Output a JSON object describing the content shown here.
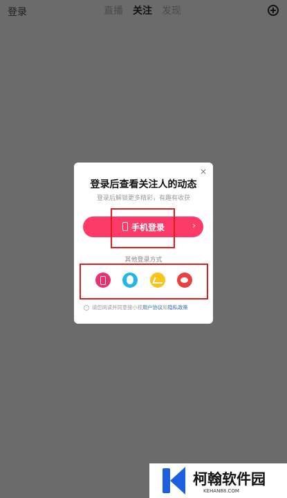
{
  "topbar": {
    "login_label": "登录",
    "tabs": [
      {
        "label": "直播",
        "active": false
      },
      {
        "label": "关注",
        "active": true
      },
      {
        "label": "发现",
        "active": false
      }
    ],
    "add_icon": "plus-circle-icon"
  },
  "dialog": {
    "close_glyph": "×",
    "title": "登录后查看关注人的动态",
    "subtitle": "登录后解锁更多精彩，有趣有收获",
    "phone_login": {
      "label": "手机登录",
      "arrow": "›",
      "icon": "phone-icon"
    },
    "other_methods_label": "其他登录方式",
    "methods": [
      {
        "name": "phone",
        "icon": "phone-icon",
        "color": "#ee2f6f"
      },
      {
        "name": "qq",
        "icon": "qq-icon",
        "color": "#25b5ee"
      },
      {
        "name": "wechat",
        "icon": "wechat-icon",
        "color": "#f9c51b"
      },
      {
        "name": "weibo",
        "icon": "weibo-icon",
        "color": "#e8413f"
      }
    ],
    "agreement": {
      "prefix": "请您阅读并同意接小视",
      "user_agreement": "用户协议",
      "and": "和",
      "privacy_policy": "隐私政策"
    }
  },
  "watermark": {
    "name": "柯翰软件园",
    "url": "KEHAN88.COM",
    "color": "#1d5fe1"
  },
  "colors": {
    "overlay": "#6b6b6b",
    "accent": "#fd3b69",
    "highlight_box": "#e21b1b"
  }
}
